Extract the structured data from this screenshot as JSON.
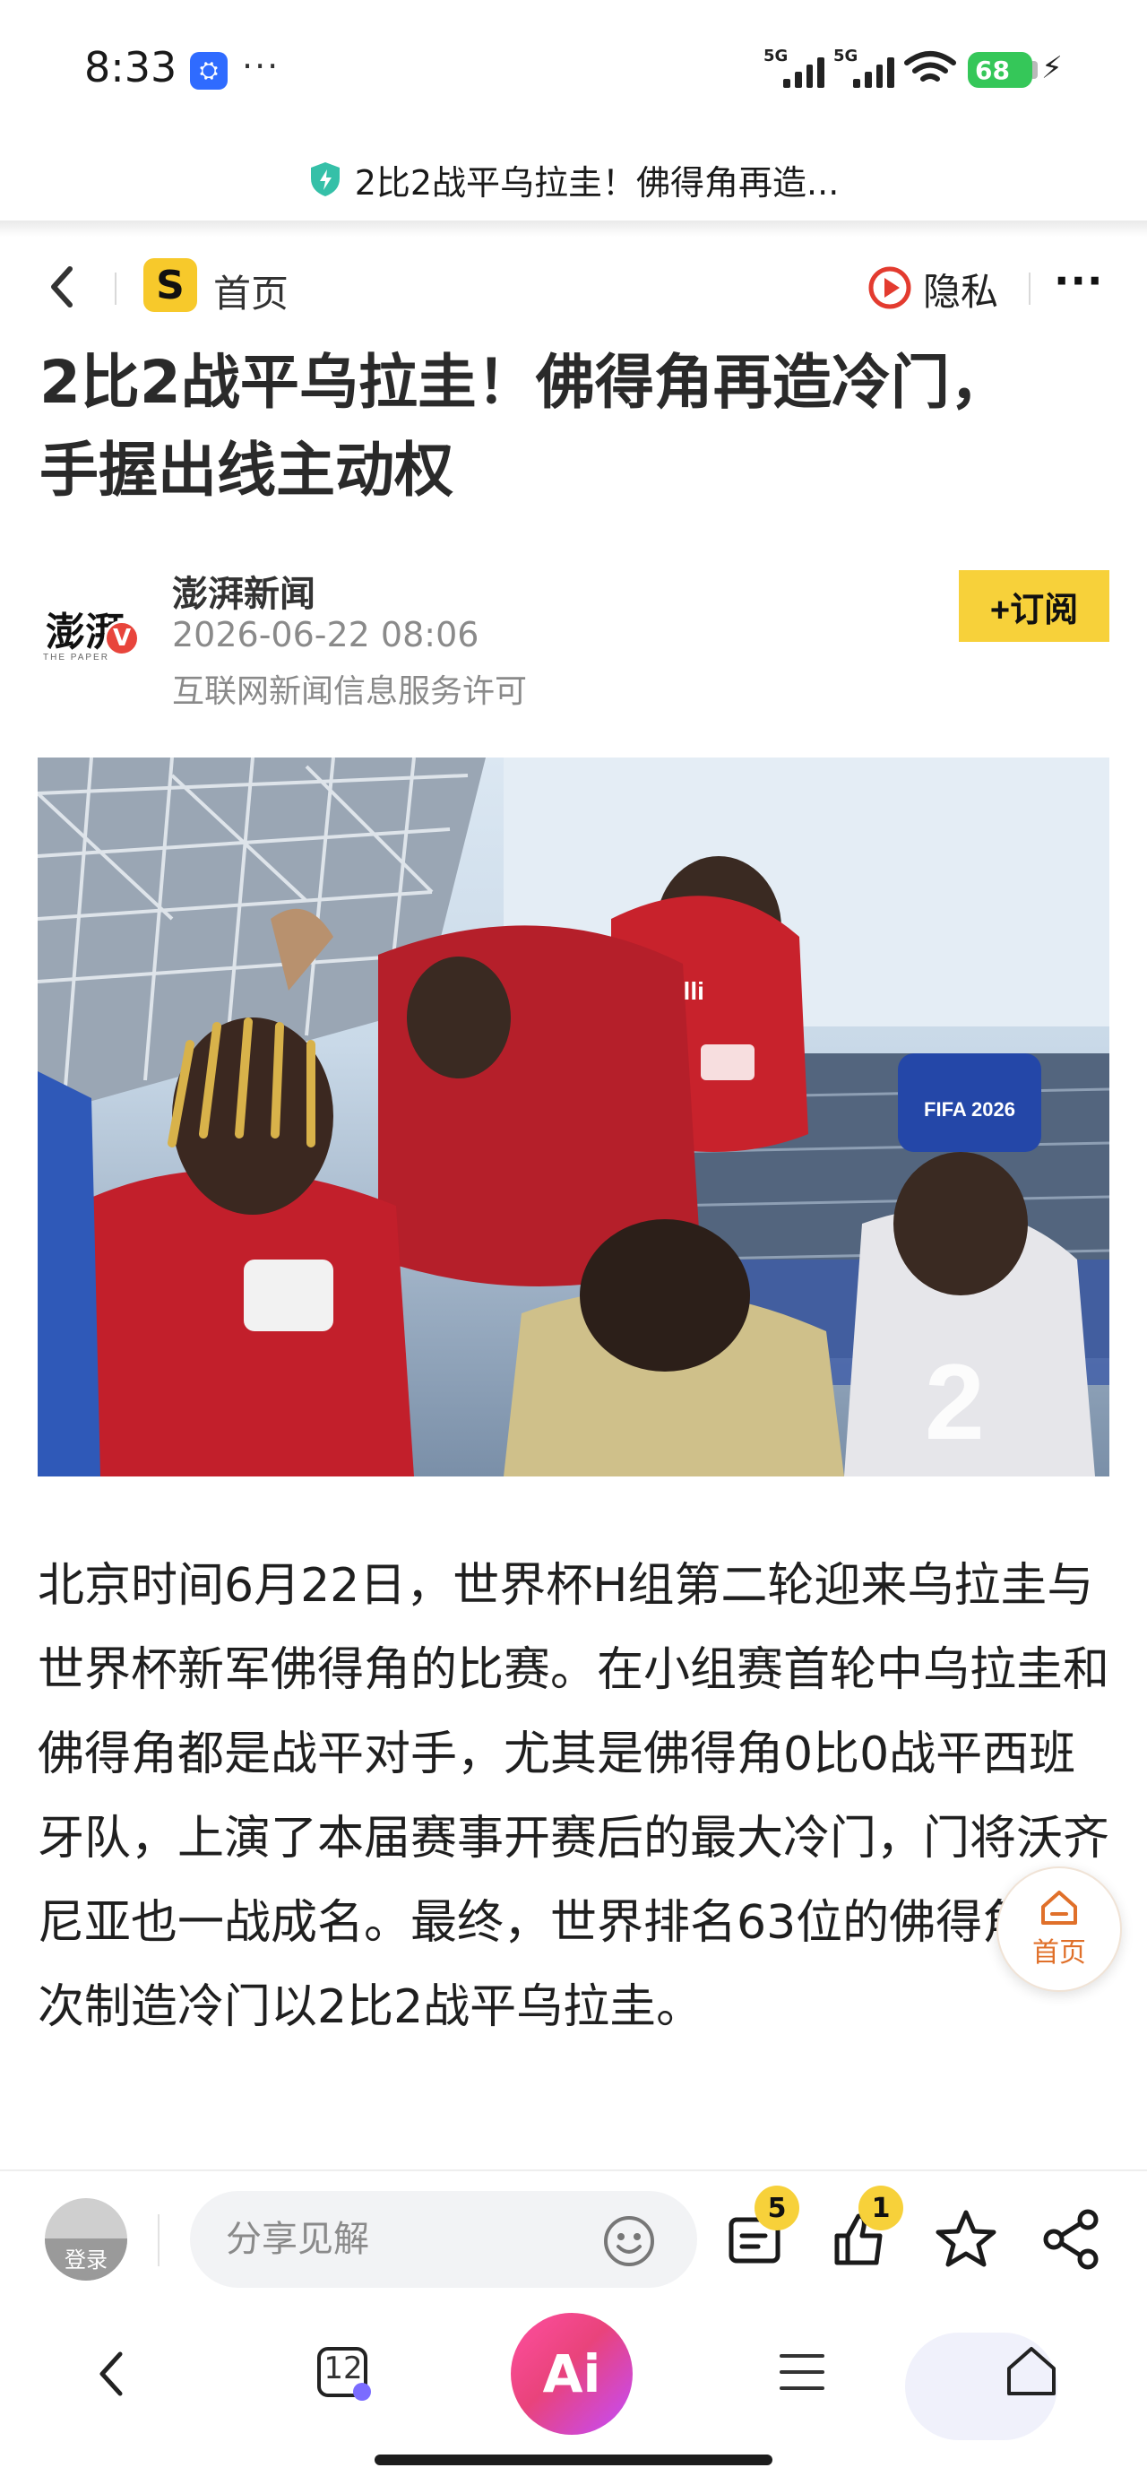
{
  "status_bar": {
    "time": "8:33",
    "app_badge": "⛭",
    "dots": "···",
    "signal_1": "5G",
    "signal_2": "5G",
    "battery": "68"
  },
  "browser": {
    "url_title": "2比2战平乌拉圭！佛得角再造...",
    "secure_color": "#35c0a8"
  },
  "nav": {
    "logo_letter": "S",
    "home_label": "首页",
    "privacy_label": "隐私",
    "more": "···"
  },
  "article": {
    "title_line1": "2比2战平乌拉圭！佛得角再造冷门，",
    "title_line2": "手握出线主动权",
    "author": {
      "avatar_text": "澎湃",
      "avatar_sub": "THE PAPER",
      "verified": "V",
      "name": "澎湃新闻",
      "time": "2026-06-22 08:06",
      "license": "互联网新闻信息服务许可",
      "subscribe_label": "+订阅"
    },
    "body": "北京时间6月22日，世界杯H组第二轮迎来乌拉圭与世界杯新军佛得角的比赛。在小组赛首轮中乌拉圭和佛得角都是战平对手，尤其是佛得角0比0战平西班牙队，上演了本届赛事开赛后的最大冷门，门将沃齐尼亚也一战成名。最终，世界排名63位的佛得角再次制造冷门以2比2战平乌拉圭。"
  },
  "hero_image": {
    "jersey_number": "2",
    "sponsor": "Opelli",
    "banner": "FIFA 2026"
  },
  "float_home": {
    "label": "首页"
  },
  "comment_bar": {
    "login_label": "登录",
    "share_placeholder": "分享见解",
    "comments_count": "5",
    "likes_count": "1"
  },
  "nav_bar": {
    "tabs_count": "12",
    "ai_label": "Ai"
  },
  "colors": {
    "accent_yellow": "#f7d13a",
    "badge_red": "#e8453c",
    "float_orange": "#e0702a"
  }
}
